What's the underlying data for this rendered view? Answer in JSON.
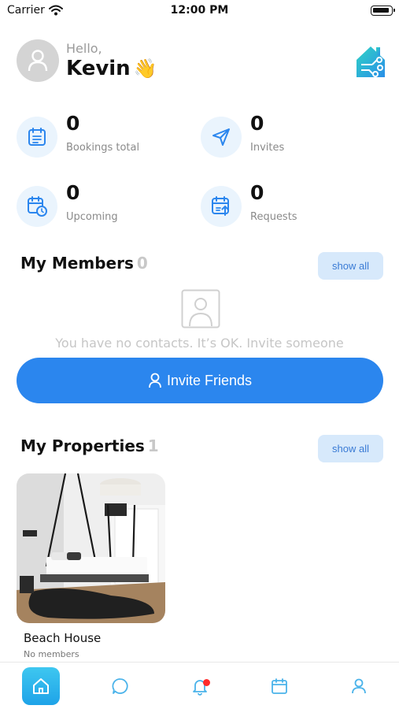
{
  "status_bar": {
    "carrier": "Carrier",
    "time": "12:00 PM"
  },
  "header": {
    "greeting": "Hello,",
    "user_name": "Kevin",
    "wave_emoji": "👋"
  },
  "stats": [
    {
      "value": "0",
      "label": "Bookings total",
      "icon": "calendar-list-icon"
    },
    {
      "value": "0",
      "label": "Invites",
      "icon": "send-icon"
    },
    {
      "value": "0",
      "label": "Upcoming",
      "icon": "calendar-clock-icon"
    },
    {
      "value": "0",
      "label": "Requests",
      "icon": "calendar-upload-icon"
    }
  ],
  "members": {
    "title": "My Members",
    "count": "0",
    "show_all_label": "show all",
    "empty_text": "You have no contacts. It’s OK. Invite someone",
    "invite_button_label": "Invite Friends"
  },
  "properties": {
    "title": "My Properties",
    "count": "1",
    "show_all_label": "show all",
    "items": [
      {
        "name": "Beach House",
        "subtitle": "No members"
      }
    ]
  },
  "tab_bar": {
    "tabs": [
      "home-icon",
      "chat-icon",
      "bell-icon",
      "calendar-icon",
      "user-icon"
    ],
    "active_index": 0,
    "notification_badge": true
  },
  "colors": {
    "accent": "#2b86ee",
    "accent_light": "#d7e9fb",
    "icon_circle": "#eaf4fd",
    "tab_active": "#1ea3e8",
    "badge": "#ff2b2b"
  }
}
